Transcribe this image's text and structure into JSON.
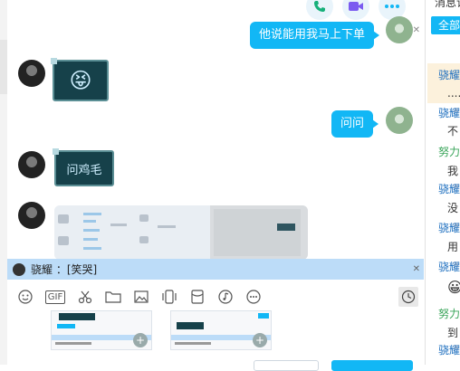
{
  "chat": {
    "messages": [
      {
        "sender": "me",
        "type": "text",
        "text": "他说能用我马上下单"
      },
      {
        "sender": "other",
        "type": "sticker",
        "emoji": "😝"
      },
      {
        "sender": "me",
        "type": "text",
        "text": "问问"
      },
      {
        "sender": "other",
        "type": "card",
        "text": "问鸡毛"
      },
      {
        "sender": "other",
        "type": "image"
      }
    ]
  },
  "top_icons": [
    "phone-icon",
    "video-call-icon",
    "more-icon"
  ],
  "quote": {
    "text": "骁耀 ：[笑哭]"
  },
  "toolbar": {
    "items": [
      "emoji-icon",
      "gif-icon",
      "scissors-icon",
      "folder-icon",
      "image-icon",
      "shake-icon",
      "red-packet-icon",
      "music-icon",
      "more-icon",
      "history-icon"
    ],
    "gif_label": "GIF"
  },
  "sidebar": {
    "title": "消息记",
    "tab_label": "全部",
    "entries": [
      {
        "name": "骁耀",
        "msg": "....",
        "color": "blue"
      },
      {
        "name": "骁耀",
        "msg": "不",
        "color": "blue"
      },
      {
        "name": "努力",
        "msg": "我",
        "color": "green"
      },
      {
        "name": "骁耀",
        "msg": "没",
        "color": "blue"
      },
      {
        "name": "骁耀",
        "msg": "用",
        "color": "blue"
      },
      {
        "name": "骁耀",
        "msg": "😀",
        "color": "blue"
      },
      {
        "name": "努力",
        "msg": "到",
        "color": "green"
      },
      {
        "name": "骁耀",
        "msg": "",
        "color": "blue"
      }
    ]
  },
  "colors": {
    "accent": "#12b7f5",
    "quote_bar": "#bcdcf8",
    "card_bg": "#16414a"
  }
}
